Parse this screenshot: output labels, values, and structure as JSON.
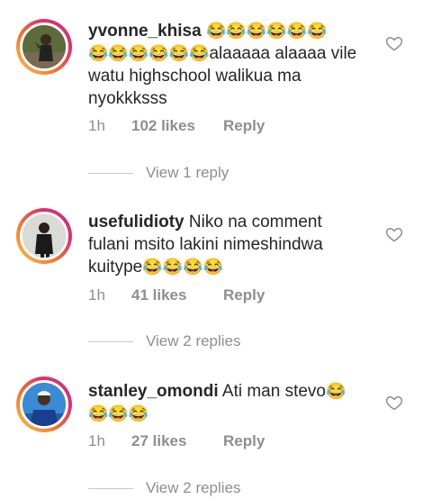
{
  "comments": [
    {
      "username": "yvonne_khisa",
      "emoji_lead": "😂😂😂😂😂😂",
      "emoji_mid": "😂😂😂😂😂😂",
      "text": "alaaaaa alaaaa vile watu highschool walikua ma nyokkksss",
      "time": "1h",
      "likes": "102 likes",
      "reply_label": "Reply",
      "view_replies": "View 1 reply"
    },
    {
      "username": "usefulidioty",
      "text": "Niko na comment fulani msito lakini nimeshindwa kuitype",
      "emoji_tail": "😂😂😂😂",
      "time": "1h",
      "likes": "41 likes",
      "reply_label": "Reply",
      "view_replies": "View 2 replies"
    },
    {
      "username": "stanley_omondi",
      "text": "Ati man stevo",
      "emoji_tail": "😂",
      "emoji_line2": "😂😂😂",
      "time": "1h",
      "likes": "27 likes",
      "reply_label": "Reply",
      "view_replies": "View 2 replies"
    }
  ],
  "colors": {
    "text": "#262626",
    "meta": "#8e8e8e",
    "story_ring_start": "#f9c74f",
    "story_ring_end": "#c13584"
  },
  "icons": {
    "like": "heart-outline-icon",
    "emoji": "face-with-tears-of-joy"
  }
}
